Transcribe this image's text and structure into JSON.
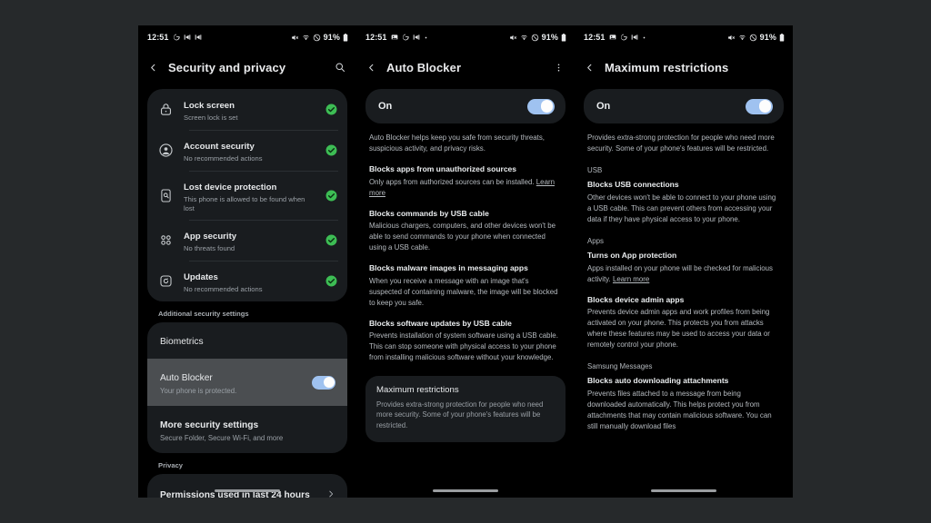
{
  "meta": {
    "background_color": "#26292b",
    "screen_background": "#000000",
    "accent_toggle_color": "#9fc2f0",
    "status_ok_color": "#3dbd54",
    "card_color": "#191c1f",
    "highlight_row_color": "#4b4e51"
  },
  "panels": [
    {
      "id": "security-and-privacy",
      "statusbar": {
        "time": "12:51",
        "left_icons": [
          "google-icon",
          "app-icon",
          "app-icon"
        ],
        "right_icons": [
          "mute-icon",
          "wifi-icon",
          "dnd-icon"
        ],
        "battery_percent": "91%",
        "battery_icon": "battery-icon"
      },
      "appbar": {
        "back_icon": "back-chevron-icon",
        "title": "Security and privacy",
        "action_icon": "search-icon"
      },
      "status_items": [
        {
          "icon": "lock-icon",
          "title": "Lock screen",
          "subtitle": "Screen lock is set",
          "badge": "check-circle-icon"
        },
        {
          "icon": "account-icon",
          "title": "Account security",
          "subtitle": "No recommended actions",
          "badge": "check-circle-icon"
        },
        {
          "icon": "find-device-icon",
          "title": "Lost device protection",
          "subtitle": "This phone is allowed to be found when lost",
          "badge": "check-circle-icon"
        },
        {
          "icon": "app-grid-icon",
          "title": "App security",
          "subtitle": "No threats found",
          "badge": "check-circle-icon"
        },
        {
          "icon": "update-icon",
          "title": "Updates",
          "subtitle": "No recommended actions",
          "badge": "check-circle-icon"
        }
      ],
      "additional_label": "Additional security settings",
      "additional_items": [
        {
          "title": "Biometrics",
          "subtitle": "",
          "toggle": null,
          "highlighted": false
        },
        {
          "title": "Auto Blocker",
          "subtitle": "Your phone is protected.",
          "toggle": "on",
          "highlighted": true
        },
        {
          "title": "More security settings",
          "subtitle": "Secure Folder, Secure Wi-Fi, and more",
          "toggle": null,
          "highlighted": false
        }
      ],
      "privacy_label": "Privacy",
      "privacy_item": {
        "title": "Permissions used in last 24 hours",
        "chevron": "chevron-right-icon"
      }
    },
    {
      "id": "auto-blocker",
      "statusbar": {
        "time": "12:51",
        "left_icons": [
          "photos-icon",
          "google-icon",
          "app-icon",
          "dot-icon"
        ],
        "right_icons": [
          "mute-icon",
          "wifi-icon",
          "dnd-icon"
        ],
        "battery_percent": "91%",
        "battery_icon": "battery-icon"
      },
      "appbar": {
        "back_icon": "back-chevron-icon",
        "title": "Auto Blocker",
        "action_icon": "more-options-icon"
      },
      "toggle_bar": {
        "label": "On",
        "state": "on"
      },
      "intro": "Auto Blocker helps keep you safe from security threats, suspicious activity, and privacy risks.",
      "blocks": [
        {
          "heading": "Blocks apps from unauthorized sources",
          "paragraph": "Only apps from authorized sources can be installed.",
          "link": "Learn more"
        },
        {
          "heading": "Blocks commands by USB cable",
          "paragraph": "Malicious chargers, computers, and other devices won't be able to send commands to your phone when connected using a USB cable.",
          "link": ""
        },
        {
          "heading": "Blocks malware images in messaging apps",
          "paragraph": "When you receive a message with an image that's suspected of containing malware, the image will be blocked to keep you safe.",
          "link": ""
        },
        {
          "heading": "Blocks software updates by USB cable",
          "paragraph": "Prevents installation of system software using a USB cable. This can stop someone with physical access to your phone from installing malicious software without your knowledge.",
          "link": ""
        }
      ],
      "max_card": {
        "title": "Maximum restrictions",
        "paragraph": "Provides extra-strong protection for people who need more security. Some of your phone's features will be restricted."
      }
    },
    {
      "id": "maximum-restrictions",
      "statusbar": {
        "time": "12:51",
        "left_icons": [
          "photos-icon",
          "google-icon",
          "app-icon",
          "dot-icon"
        ],
        "right_icons": [
          "mute-icon",
          "wifi-icon",
          "dnd-icon"
        ],
        "battery_percent": "91%",
        "battery_icon": "battery-icon"
      },
      "appbar": {
        "back_icon": "back-chevron-icon",
        "title": "Maximum restrictions",
        "action_icon": ""
      },
      "toggle_bar": {
        "label": "On",
        "state": "on"
      },
      "intro": "Provides extra-strong protection for people who need more security. Some of your phone's features will be restricted.",
      "sections": [
        {
          "category": "USB",
          "heading": "Blocks USB connections",
          "paragraph": "Other devices won't be able to connect to your phone using a USB cable. This can prevent others from accessing your data if they have physical access to your phone.",
          "link": ""
        },
        {
          "category": "Apps",
          "heading": "Turns on App protection",
          "paragraph": "Apps installed on your phone will be checked for malicious activity.",
          "link": "Learn more"
        },
        {
          "category": "",
          "heading": "Blocks device admin apps",
          "paragraph": "Prevents device admin apps and work profiles from being activated on your phone. This protects you from attacks where these features may be used to access your data or remotely control your phone.",
          "link": ""
        },
        {
          "category": "Samsung Messages",
          "heading": "Blocks auto downloading attachments",
          "paragraph": "Prevents files attached to a message from being downloaded automatically. This helps protect you from attachments that may contain malicious software. You can still manually download files",
          "link": ""
        }
      ]
    }
  ]
}
